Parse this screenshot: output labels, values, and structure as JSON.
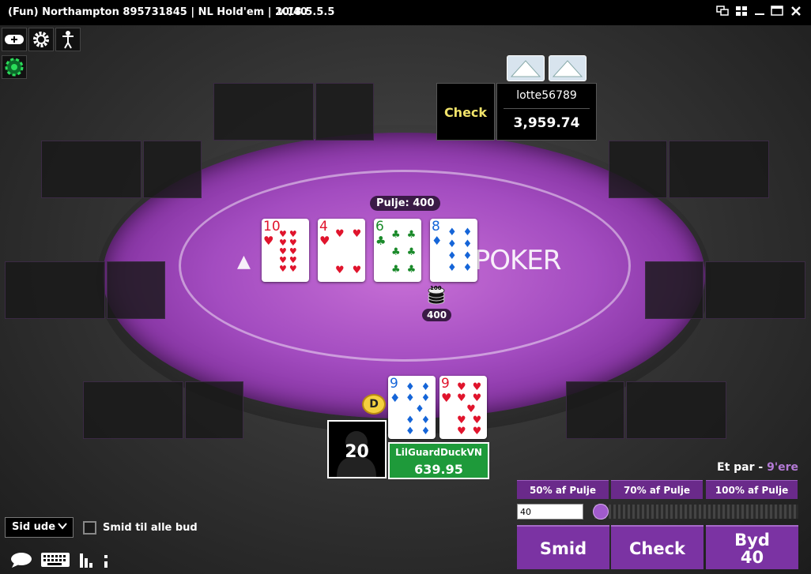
{
  "window": {
    "title": "(Fun) Northampton 895731845 | NL Hold'em | 20/40",
    "version": "v.18.5.5.5"
  },
  "table": {
    "logo_text": "POKER",
    "pot_label": "Pulje: 400",
    "bet_chip_amount": "400",
    "chip_denomination": "100",
    "board_cards": [
      {
        "rank": "10",
        "suit": "hearts",
        "symbol": "♥",
        "color": "#e0142c"
      },
      {
        "rank": "4",
        "suit": "hearts",
        "symbol": "♥",
        "color": "#e0142c"
      },
      {
        "rank": "6",
        "suit": "clubs",
        "symbol": "♣",
        "color": "#1a8a2a"
      },
      {
        "rank": "8",
        "suit": "diamonds",
        "symbol": "♦",
        "color": "#1565d8"
      }
    ]
  },
  "opponent": {
    "action": "Check",
    "name": "lotte56789",
    "stack": "3,959.74"
  },
  "hero": {
    "name": "LilGuardDuckVN",
    "stack": "639.95",
    "timer": "20",
    "dealer_label": "D",
    "hole_cards": [
      {
        "rank": "9",
        "suit": "diamonds",
        "symbol": "♦",
        "color": "#1565d8"
      },
      {
        "rank": "9",
        "suit": "hearts",
        "symbol": "♥",
        "color": "#e0142c"
      }
    ],
    "hand_rank_prefix": "Et par - ",
    "hand_rank_value": "9'ere"
  },
  "bet_controls": {
    "presets": [
      "50% af Pulje",
      "70% af Pulje",
      "100% af Pulje"
    ],
    "bet_value": "40",
    "fold": "Smid",
    "check": "Check",
    "bet_label": "Byd",
    "bet_amount": "40"
  },
  "bottom": {
    "sit_out": "Sid ude",
    "fold_to_any": "Smid til alle bud"
  },
  "colors": {
    "felt": "#a34cc0",
    "button": "#7b33a3",
    "hero_box": "#1e9a3a",
    "action_text": "#f1e36a"
  }
}
